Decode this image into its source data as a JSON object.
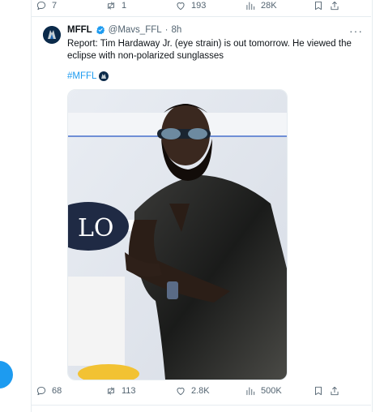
{
  "top_actions": {
    "reply_count": "7",
    "retweet_count": "1",
    "like_count": "193",
    "view_count": "28K"
  },
  "tweet": {
    "author_name": "MFFL",
    "handle": "@Mavs_FFL",
    "separator": "·",
    "time": "8h",
    "more": "···",
    "text": "Report: Tim Hardaway Jr. (eye strain) is out tomorrow. He viewed the eclipse with non-polarized sunglasses",
    "hashtag": "#MFFL",
    "banner_text": "LO",
    "actions": {
      "reply_count": "68",
      "retweet_count": "113",
      "like_count": "2.8K",
      "view_count": "500K"
    }
  },
  "colors": {
    "accent": "#1d9bf0",
    "muted": "#536471",
    "text": "#0f1419",
    "border": "#e6ecf0"
  },
  "icons": [
    "reply-icon",
    "retweet-icon",
    "like-icon",
    "views-icon",
    "bookmark-icon",
    "share-icon",
    "verified-badge-icon",
    "mavs-hashflag-icon"
  ]
}
